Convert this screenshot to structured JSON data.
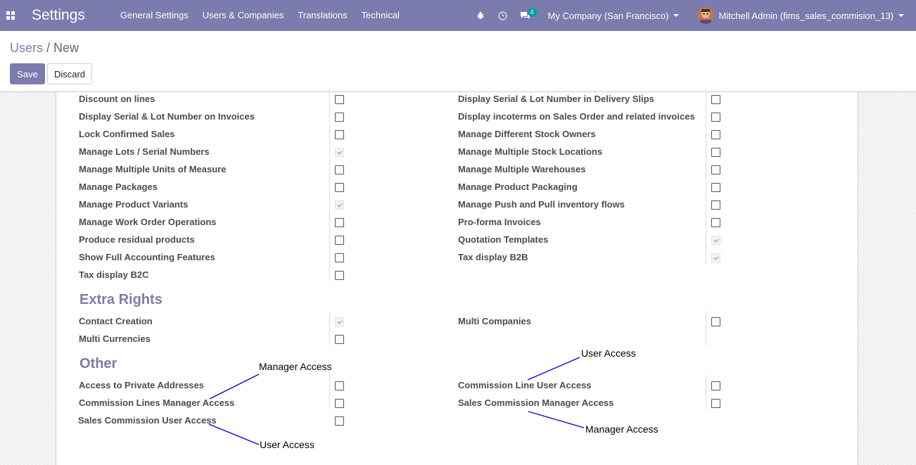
{
  "navbar": {
    "apps_icon": "apps-grid-icon",
    "brand": "Settings",
    "menu": [
      "General Settings",
      "Users & Companies",
      "Translations",
      "Technical"
    ],
    "bug_icon": "bug-icon",
    "clock_icon": "clock-icon",
    "chat_icon": "chat-icon",
    "chat_badge": "4",
    "company": "My Company (San Francisco)",
    "user": "Mitchell Admin (fims_sales_commision_13)"
  },
  "breadcrumb": {
    "parent": "Users",
    "separator": "/",
    "current": "New"
  },
  "buttons": {
    "save": "Save",
    "discard": "Discard"
  },
  "technical": {
    "left": [
      {
        "label": "Discount on lines",
        "checked": false
      },
      {
        "label": "Display Serial & Lot Number on Invoices",
        "checked": false
      },
      {
        "label": "Lock Confirmed Sales",
        "checked": false
      },
      {
        "label": "Manage Lots / Serial Numbers",
        "checked": true
      },
      {
        "label": "Manage Multiple Units of Measure",
        "checked": false
      },
      {
        "label": "Manage Packages",
        "checked": false
      },
      {
        "label": "Manage Product Variants",
        "checked": true
      },
      {
        "label": "Manage Work Order Operations",
        "checked": false
      },
      {
        "label": "Produce residual products",
        "checked": false
      },
      {
        "label": "Show Full Accounting Features",
        "checked": false
      },
      {
        "label": "Tax display B2C",
        "checked": false
      }
    ],
    "right": [
      {
        "label": "Display Serial & Lot Number in Delivery Slips",
        "checked": false
      },
      {
        "label": "Display incoterms on Sales Order and related invoices",
        "checked": false
      },
      {
        "label": "Manage Different Stock Owners",
        "checked": false
      },
      {
        "label": "Manage Multiple Stock Locations",
        "checked": false
      },
      {
        "label": "Manage Multiple Warehouses",
        "checked": false
      },
      {
        "label": "Manage Product Packaging",
        "checked": false
      },
      {
        "label": "Manage Push and Pull inventory flows",
        "checked": false
      },
      {
        "label": "Pro-forma Invoices",
        "checked": false
      },
      {
        "label": "Quotation Templates",
        "checked": true
      },
      {
        "label": "Tax display B2B",
        "checked": true
      }
    ]
  },
  "extra_rights": {
    "title": "Extra Rights",
    "left": [
      {
        "label": "Contact Creation",
        "checked": true
      },
      {
        "label": "Multi Currencies",
        "checked": false
      }
    ],
    "right": [
      {
        "label": "Multi Companies",
        "checked": false
      }
    ]
  },
  "other": {
    "title": "Other",
    "left": [
      {
        "label": "Access to Private Addresses",
        "checked": false
      },
      {
        "label": "Commission Lines Manager Access",
        "checked": false
      },
      {
        "label": "Sales Commission User Access",
        "checked": false
      }
    ],
    "right": [
      {
        "label": "Commission Line User Access",
        "checked": false
      },
      {
        "label": "Sales Commission Manager Access",
        "checked": false
      }
    ]
  },
  "annotations": {
    "manager_access_left": "Manager Access",
    "user_access_left": "User Access",
    "user_access_right": "User Access",
    "manager_access_right": "Manager Access",
    "line_color": "#0000cc"
  },
  "colors": {
    "brand": "#7c7bad",
    "badge": "#00a09d"
  }
}
